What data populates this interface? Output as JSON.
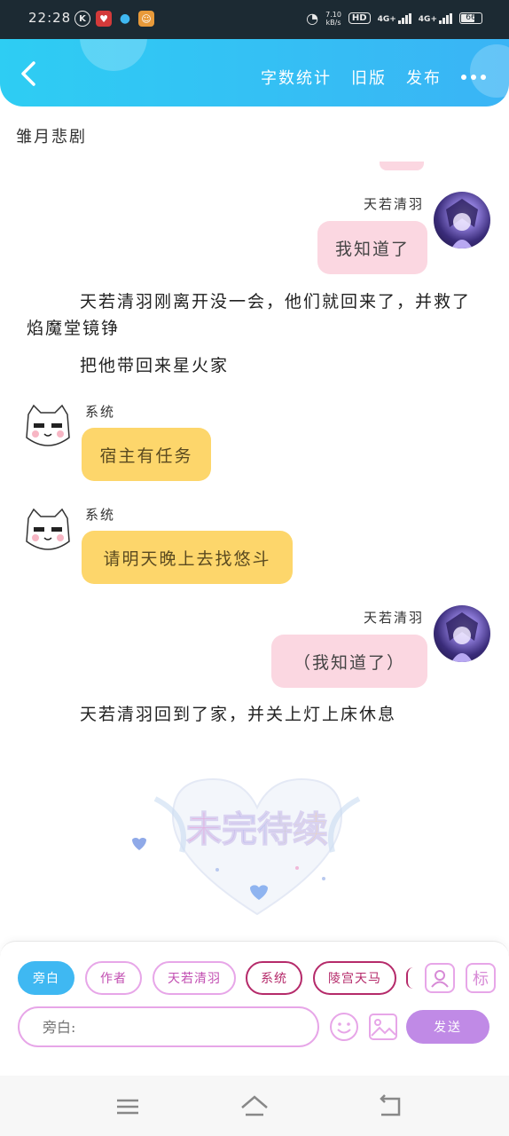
{
  "status_bar": {
    "time": "22:28",
    "net_speed_value": "7.10",
    "net_speed_unit": "kB/s",
    "hd_label": "HD",
    "sim1": "4G+",
    "sim2": "4G+",
    "battery": "66"
  },
  "header": {
    "word_count": "字数统计",
    "old_version": "旧版",
    "publish": "发布"
  },
  "story_title": "雏月悲剧",
  "messages": [
    {
      "speaker": "天若清羽",
      "text": "我知道了"
    },
    {
      "narration": "天若清羽刚离开没一会，他们就回来了，并救了焰魔堂镜铮"
    },
    {
      "narration": "把他带回来星火家"
    },
    {
      "speaker": "系统",
      "text": "宿主有任务"
    },
    {
      "speaker": "系统",
      "text": "请明天晚上去找悠斗"
    },
    {
      "speaker": "天若清羽",
      "text": "（我知道了）"
    },
    {
      "narration": "天若清羽回到了家，并关上灯上床休息"
    }
  ],
  "roles": [
    "旁白",
    "作者",
    "天若清羽",
    "系统",
    "陵宫天马"
  ],
  "tag_button": "标",
  "input": {
    "placeholder": "旁白:"
  },
  "send_label": "发送",
  "colors": {
    "header": "#2ecdf3",
    "pink_bubble": "#fbd7e1",
    "yellow_bubble": "#fdd66b",
    "send": "#c08ae6"
  }
}
